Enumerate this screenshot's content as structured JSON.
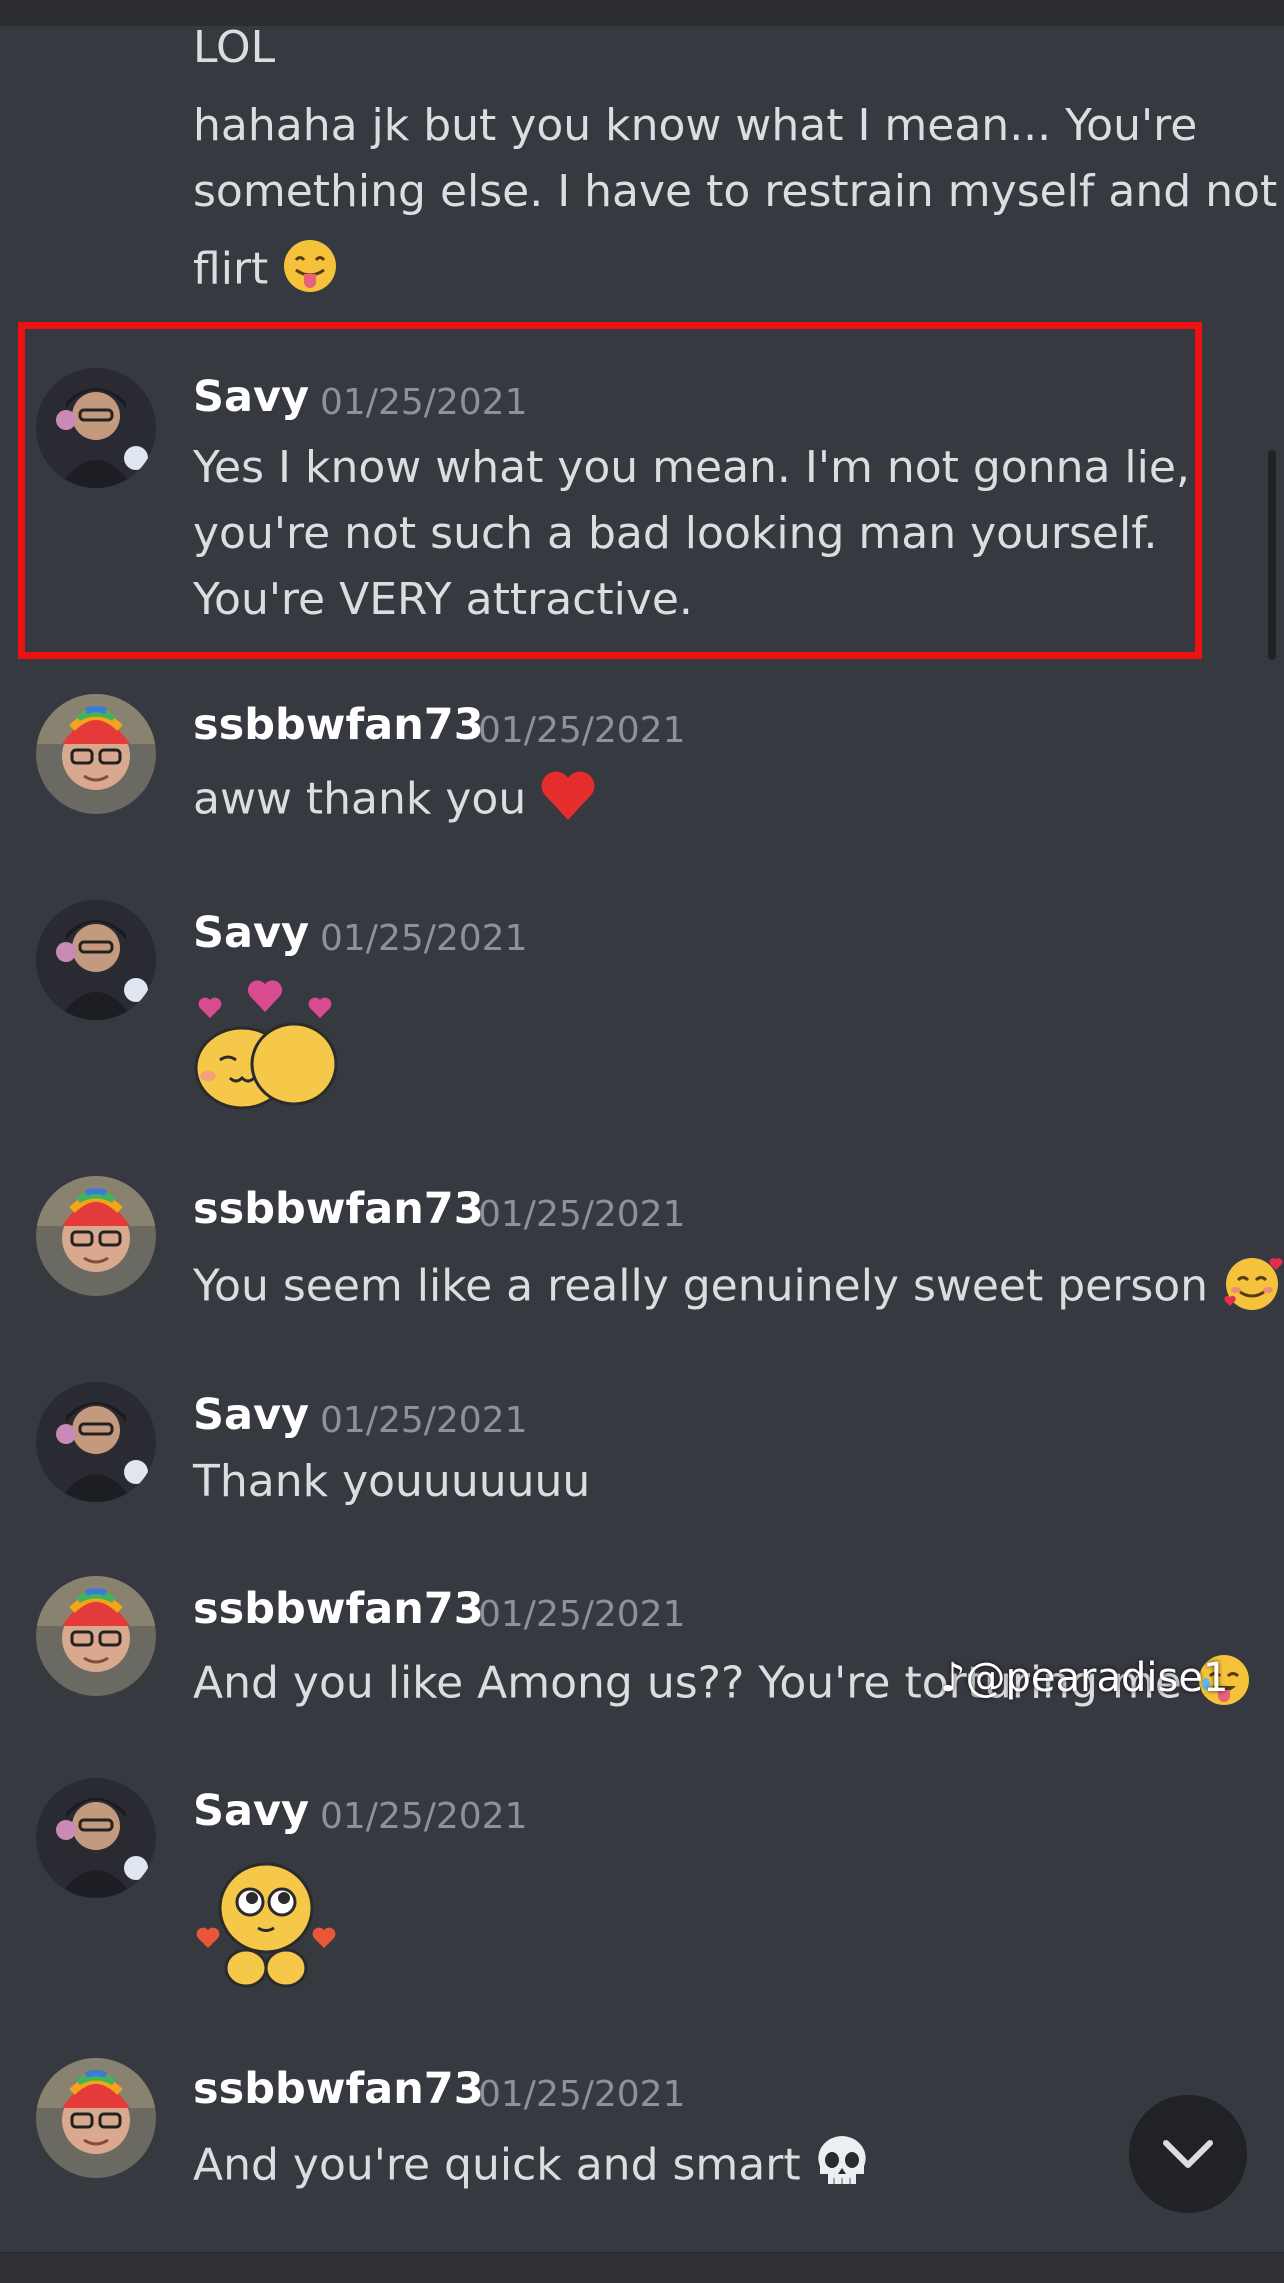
{
  "continuation": {
    "lines": [
      "LOL",
      "hahaha jk but you know what I mean... You're",
      "something else. I have to restrain myself and not",
      "flirt"
    ],
    "emoji": "tongue-out-emoji"
  },
  "messages": [
    {
      "username": "Savy",
      "timestamp": "01/25/2021",
      "avatar": "savy-avatar",
      "lines": [
        "Yes I know what you mean. I'm not gonna lie,",
        "you're not such a bad looking man yourself.",
        "You're VERY attractive."
      ],
      "highlighted": true
    },
    {
      "username": "ssbbwfan73",
      "timestamp": "01/25/2021",
      "avatar": "ssbbwfan73-avatar",
      "lines": [
        "aww thank you"
      ],
      "emoji": "red-heart-emoji"
    },
    {
      "username": "Savy",
      "timestamp": "01/25/2021",
      "avatar": "savy-avatar",
      "lines": [],
      "sticker": "hug-hearts-sticker"
    },
    {
      "username": "ssbbwfan73",
      "timestamp": "01/25/2021",
      "avatar": "ssbbwfan73-avatar",
      "lines": [
        "You seem like a really genuinely sweet person"
      ],
      "emoji": "smiling-face-with-hearts-emoji"
    },
    {
      "username": "Savy",
      "timestamp": "01/25/2021",
      "avatar": "savy-avatar",
      "lines": [
        "Thank youuuuuuu"
      ]
    },
    {
      "username": "ssbbwfan73",
      "timestamp": "01/25/2021",
      "avatar": "ssbbwfan73-avatar",
      "lines": [
        "And you like Among us?? You're torturing me"
      ],
      "emoji": "face-with-tears-emoji"
    },
    {
      "username": "Savy",
      "timestamp": "01/25/2021",
      "avatar": "savy-avatar",
      "lines": [],
      "sticker": "pleading-hearts-sticker"
    },
    {
      "username": "ssbbwfan73",
      "timestamp": "01/25/2021",
      "avatar": "ssbbwfan73-avatar",
      "lines": [
        "And you're quick and smart"
      ],
      "emoji": "skull-emoji"
    }
  ],
  "watermark": "@pearadise1",
  "jump_button": {
    "icon": "chevron-down-icon"
  },
  "colors": {
    "background": "#36393f",
    "text": "#dcddde",
    "username": "#ffffff",
    "timestamp": "#8e9297",
    "highlight": "#ee1111"
  }
}
